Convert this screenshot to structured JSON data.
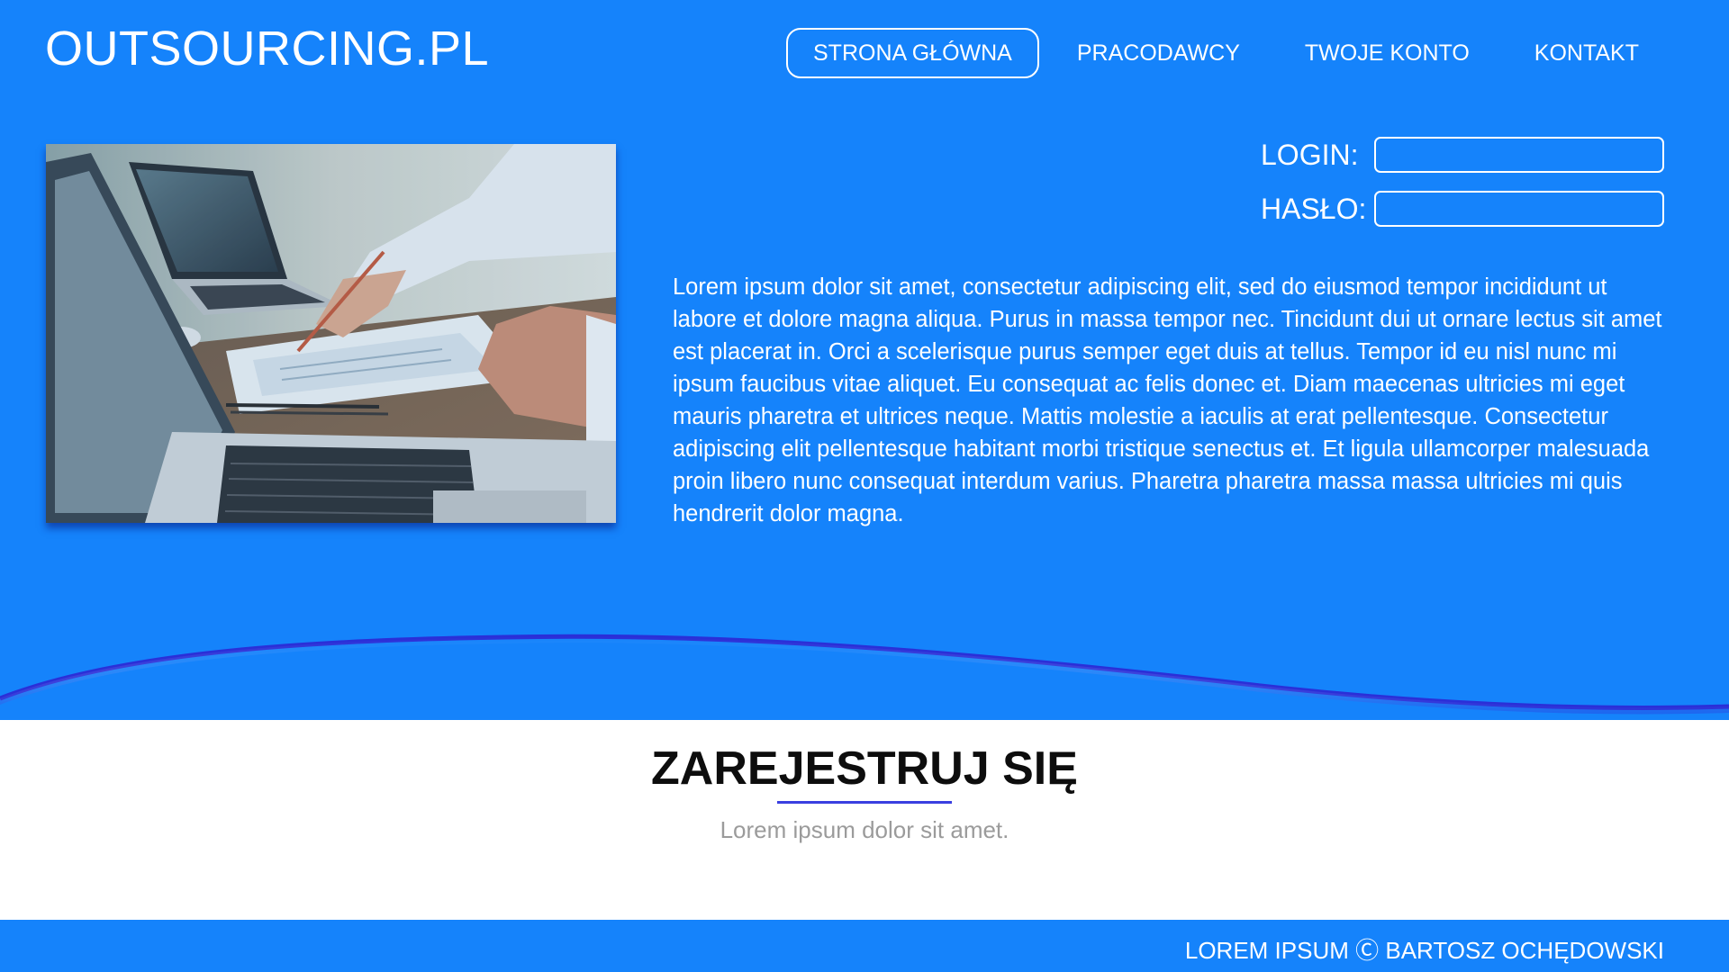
{
  "header": {
    "logo": "OUTSOURCING.PL",
    "nav": [
      {
        "label": "STRONA GŁÓWNA",
        "active": true
      },
      {
        "label": "PRACODAWCY",
        "active": false
      },
      {
        "label": "TWOJE KONTO",
        "active": false
      },
      {
        "label": "KONTAKT",
        "active": false
      }
    ]
  },
  "hero": {
    "photo_icon": "laptops-desk-photo",
    "login": {
      "label": "LOGIN:",
      "value": ""
    },
    "password": {
      "label": "HASŁO:",
      "value": ""
    },
    "text": "Lorem ipsum dolor sit amet, consectetur adipiscing elit, sed do eiusmod tempor incididunt ut labore et dolore magna aliqua. Purus in massa tempor nec. Tincidunt dui ut ornare lectus sit amet est placerat in. Orci a scelerisque purus semper eget duis at tellus. Tempor id eu nisl nunc mi ipsum faucibus vitae aliquet. Eu consequat ac felis donec et. Diam maecenas ultricies mi eget mauris pharetra et ultrices neque. Mattis molestie a iaculis at erat pellentesque. Consectetur adipiscing elit pellentesque habitant morbi tristique senectus et. Et ligula ullamcorper malesuada proin libero nunc consequat interdum varius. Pharetra pharetra massa massa ultricies mi quis hendrerit dolor magna."
  },
  "register": {
    "title": "ZAREJESTRUJ SIĘ",
    "subtitle": "Lorem ipsum dolor sit amet."
  },
  "footer": {
    "text": "LOREM IPSUM Ⓒ BARTOSZ OCHĘDOWSKI"
  },
  "colors": {
    "primary": "#1583fb",
    "accent_underline": "#3a3fe0",
    "wave_edge": "#2a2fd8",
    "subtitle_gray": "#9b9b9b"
  }
}
